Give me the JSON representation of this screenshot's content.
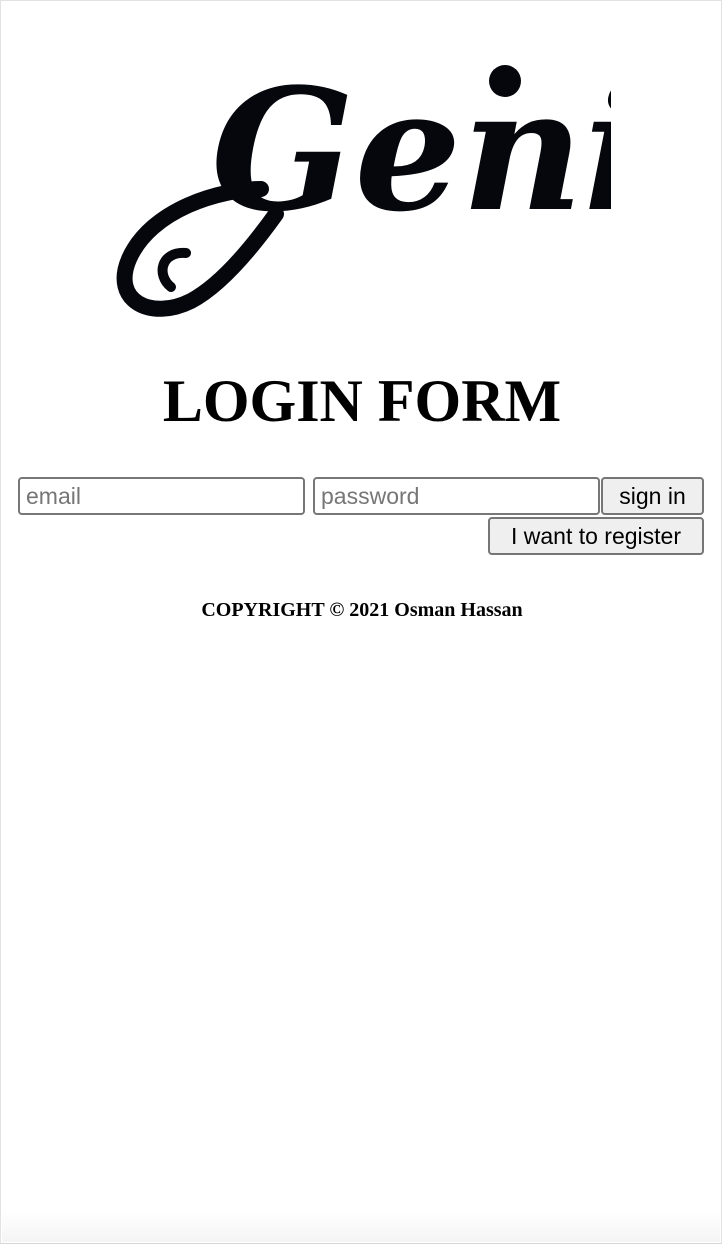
{
  "logo": {
    "text": "Genie",
    "color": "#05070d"
  },
  "page": {
    "title": "LOGIN FORM"
  },
  "form": {
    "email_placeholder": "email",
    "email_value": "",
    "password_placeholder": "password",
    "password_value": "",
    "signin_label": "sign in",
    "register_label": "I want to register"
  },
  "footer": {
    "copyright": "COPYRIGHT © 2021 Osman Hassan"
  }
}
